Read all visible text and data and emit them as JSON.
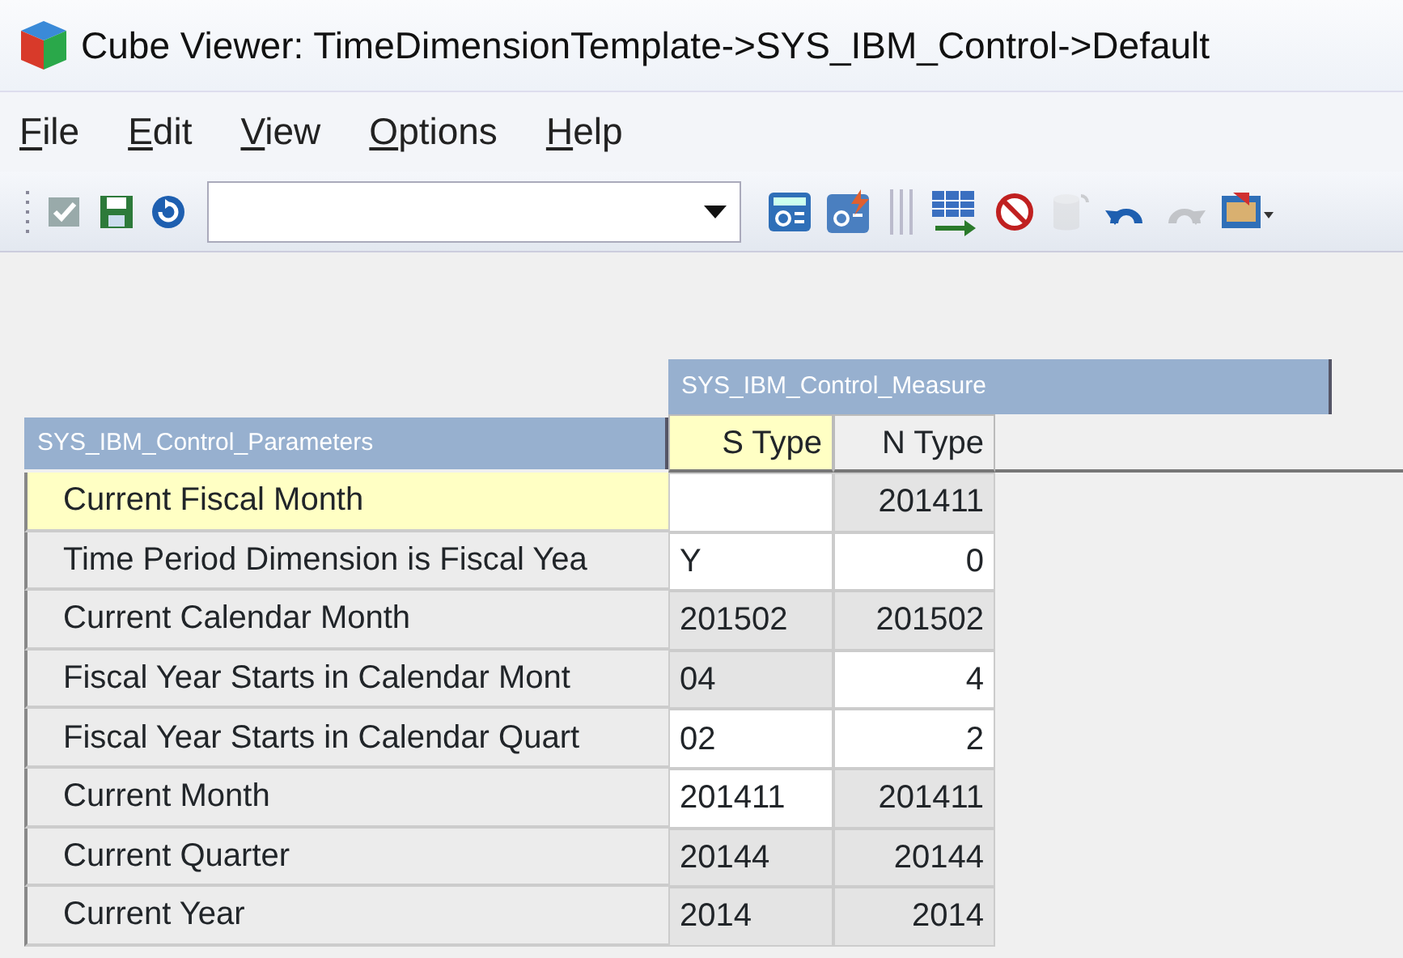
{
  "window": {
    "title": "Cube Viewer: TimeDimensionTemplate->SYS_IBM_Control->Default"
  },
  "menu": [
    {
      "label": "File"
    },
    {
      "label": "Edit"
    },
    {
      "label": "View"
    },
    {
      "label": "Options"
    },
    {
      "label": "Help"
    }
  ],
  "toolbar": [
    {
      "kind": "grip",
      "disabled": false
    },
    {
      "kind": "check",
      "disabled": false
    },
    {
      "kind": "save",
      "disabled": false
    },
    {
      "kind": "refresh",
      "disabled": false
    },
    {
      "kind": "combo",
      "disabled": false
    },
    {
      "kind": "calc",
      "disabled": false
    },
    {
      "kind": "recalc",
      "disabled": false
    },
    {
      "kind": "separator",
      "disabled": false
    },
    {
      "kind": "grid",
      "disabled": false
    },
    {
      "kind": "nosign",
      "disabled": false
    },
    {
      "kind": "cylinder",
      "disabled": true
    },
    {
      "kind": "undo",
      "disabled": false
    },
    {
      "kind": "redo",
      "disabled": true
    },
    {
      "kind": "export",
      "disabled": false
    }
  ],
  "grid": {
    "column_dimension": "SYS_IBM_Control_Measure",
    "row_dimension": "SYS_IBM_Control_Parameters",
    "columns": [
      {
        "label": "S Type",
        "kind": "string",
        "selected": true
      },
      {
        "label": "N Type",
        "kind": "numeric",
        "selected": false
      }
    ],
    "rows": [
      {
        "label": "Current Fiscal Month",
        "selected": true,
        "cells": [
          {
            "editable": true
          },
          {
            "value": "201411",
            "editable": false
          }
        ]
      },
      {
        "label": "Time Period Dimension is Fiscal Yea",
        "selected": false,
        "cells": [
          {
            "value": "Y",
            "editable": true
          },
          {
            "value": "0",
            "editable": true
          }
        ]
      },
      {
        "label": "Current Calendar Month",
        "selected": false,
        "cells": [
          {
            "value": "201502",
            "editable": false
          },
          {
            "value": "201502",
            "editable": false
          }
        ]
      },
      {
        "label": "Fiscal Year Starts in Calendar Mont",
        "selected": false,
        "cells": [
          {
            "value": "04",
            "editable": false
          },
          {
            "value": "4",
            "editable": true
          }
        ]
      },
      {
        "label": "Fiscal Year Starts in Calendar Quart",
        "selected": false,
        "cells": [
          {
            "value": "02",
            "editable": true
          },
          {
            "value": "2",
            "editable": true
          }
        ]
      },
      {
        "label": "Current Month",
        "selected": false,
        "cells": [
          {
            "value": "201411",
            "editable": true
          },
          {
            "value": "201411",
            "editable": false
          }
        ]
      },
      {
        "label": "Current Quarter",
        "selected": false,
        "cells": [
          {
            "value": "20144",
            "editable": false
          },
          {
            "value": "20144",
            "editable": false
          }
        ]
      },
      {
        "label": "Current Year",
        "selected": false,
        "cells": [
          {
            "value": "2014",
            "editable": false
          },
          {
            "value": "2014",
            "editable": false
          }
        ]
      }
    ]
  }
}
